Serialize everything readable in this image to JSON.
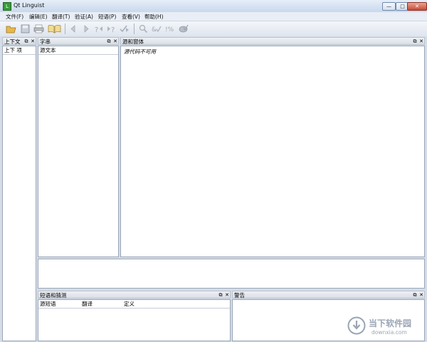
{
  "window": {
    "title": "Qt Linguist",
    "app_icon_glyph": "L",
    "controls": {
      "minimize": "—",
      "maximize": "□",
      "close": "✕"
    }
  },
  "menubar": {
    "items": [
      "文件(F)",
      "编辑(E)",
      "翻译(T)",
      "验证(A)",
      "短语(P)",
      "查看(V)",
      "帮助(H)"
    ]
  },
  "toolbar": {
    "icons": [
      "open-icon",
      "save-icon",
      "print-icon",
      "phrasebook-icon",
      "prev-icon",
      "next-icon",
      "prev-unfinished-icon",
      "next-unfinished-icon",
      "done-next-icon",
      "find-icon",
      "accelerator-check-icon",
      "punctuation-check-icon",
      "phrase-check-icon"
    ]
  },
  "docks": {
    "context": {
      "title": "上下文",
      "header": "上下  项"
    },
    "strings": {
      "title": "字串",
      "header": "源文本"
    },
    "sources": {
      "title": "源和窗体",
      "message": "源代码不可用"
    },
    "phrases": {
      "title": "短语和猜测",
      "columns": [
        "源短语",
        "翻译",
        "定义"
      ]
    },
    "warnings": {
      "title": "警告"
    }
  },
  "dock_buttons": {
    "float": "⧉",
    "close": "✕"
  },
  "watermark": {
    "brand": "当下软件园",
    "url": "downxia.com",
    "color": "#9aa5b4"
  }
}
